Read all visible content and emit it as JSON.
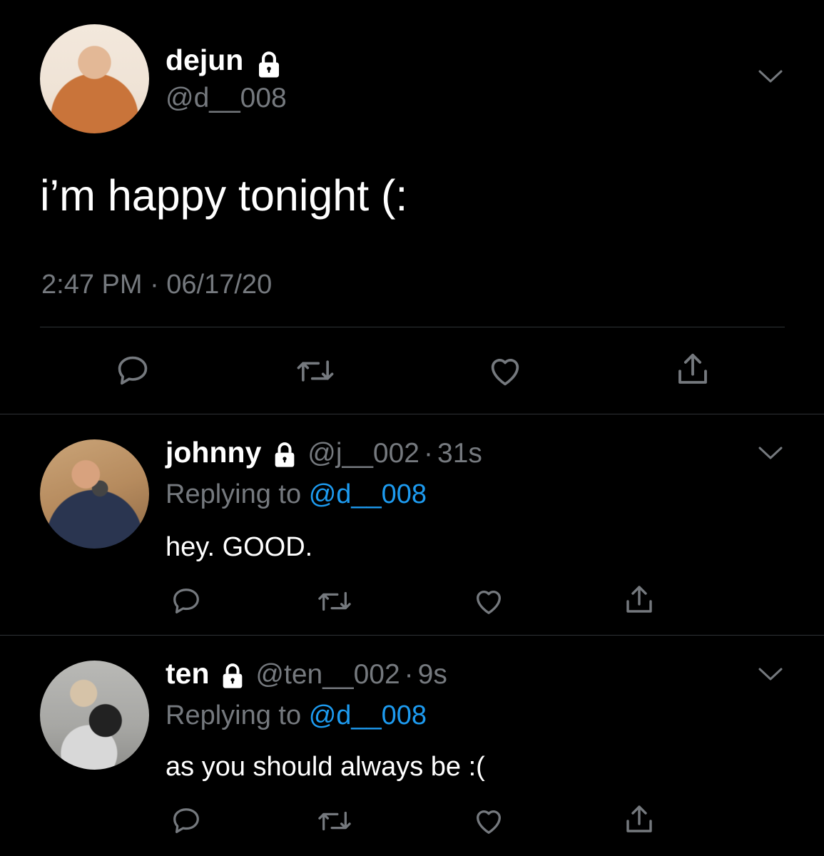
{
  "main_tweet": {
    "name": "dejun",
    "handle": "@d__008",
    "text": "i’m happy tonight (:",
    "timestamp": "2:47 PM · 06/17/20"
  },
  "replies": [
    {
      "name": "johnny",
      "handle": "@j__002",
      "dot": "·",
      "age": "31s",
      "replying_prefix": "Replying to",
      "replying_handle": "@d__008",
      "text": "hey. GOOD."
    },
    {
      "name": "ten",
      "handle": "@ten__002",
      "dot": "·",
      "age": "9s",
      "replying_prefix": "Replying to",
      "replying_handle": "@d__008",
      "text": "as you should always be :("
    }
  ],
  "icons": {
    "reply": "reply-icon",
    "retweet": "retweet-icon",
    "like": "heart-icon",
    "share": "share-icon",
    "lock": "lock-icon",
    "menu": "chevron-down-icon"
  },
  "colors": {
    "background": "#000000",
    "secondary_text": "#75797e",
    "mention": "#1d9bf0",
    "divider": "#2f3336"
  }
}
